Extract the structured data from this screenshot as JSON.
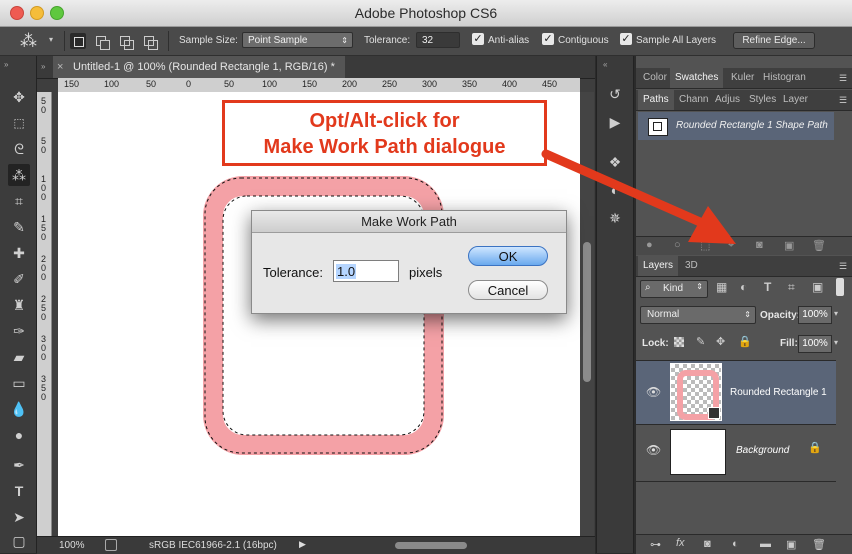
{
  "window": {
    "title": "Adobe Photoshop CS6"
  },
  "options_bar": {
    "sample_size_label": "Sample Size:",
    "sample_size_value": "Point Sample",
    "tolerance_label": "Tolerance:",
    "tolerance_value": "32",
    "anti_alias_label": "Anti-alias",
    "contiguous_label": "Contiguous",
    "sample_all_layers_label": "Sample All Layers",
    "refine_edge_label": "Refine Edge..."
  },
  "document": {
    "tab_title": "Untitled-1 @ 100% (Rounded Rectangle 1, RGB/16) *",
    "ruler_labels": [
      "150",
      "100",
      "50",
      "0",
      "50",
      "100",
      "150",
      "200",
      "250",
      "300",
      "350",
      "400",
      "450"
    ],
    "vruler_labels": [
      "5",
      "0",
      "5",
      "0",
      "1",
      "0",
      "0",
      "1",
      "5",
      "0",
      "2",
      "0",
      "0",
      "2",
      "5",
      "0",
      "3",
      "0",
      "0",
      "3",
      "5",
      "0"
    ],
    "zoom": "100%",
    "color_profile": "sRGB IEC61966-2.1 (16bpc)"
  },
  "dialog": {
    "title": "Make Work Path",
    "tolerance_label": "Tolerance:",
    "tolerance_value": "1.0",
    "units": "pixels",
    "ok_label": "OK",
    "cancel_label": "Cancel"
  },
  "annotation": {
    "line1": "Opt/Alt-click for",
    "line2": "Make Work Path dialogue",
    "color": "#e2391c"
  },
  "panels": {
    "top_tabs": [
      "Color",
      "Swatches",
      "Kuler",
      "Histogran"
    ],
    "top_selected": "Swatches",
    "paths_tabs": [
      "Paths",
      "Chann",
      "Adjus",
      "Styles",
      "Layer"
    ],
    "paths_selected": "Paths",
    "path_item": "Rounded Rectangle 1 Shape Path",
    "layers_tabs": [
      "Layers",
      "3D"
    ],
    "layers_selected": "Layers",
    "kind_label": "Kind",
    "blend_mode": "Normal",
    "opacity_label": "Opacity:",
    "opacity_value": "100%",
    "lock_label": "Lock:",
    "fill_label": "Fill:",
    "fill_value": "100%",
    "layers": [
      {
        "name": "Rounded Rectangle 1"
      },
      {
        "name": "Background"
      }
    ]
  },
  "colors": {
    "shape": "#f4a1a6",
    "selected_row": "#5a6578"
  }
}
